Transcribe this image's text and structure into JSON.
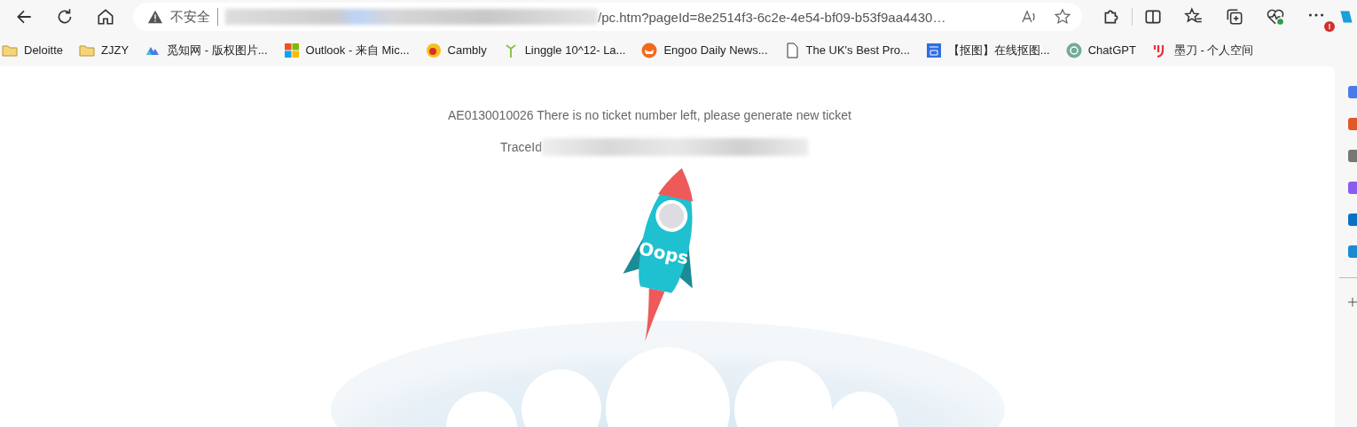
{
  "address_bar": {
    "security_label": "不安全",
    "url_visible": "/pc.htm?pageId=8e2514f3-6c2e-4e54-bf09-b53f9aa4430…"
  },
  "notification_badge": "!",
  "bookmarks": [
    {
      "kind": "folder",
      "label": "Deloitte"
    },
    {
      "kind": "folder",
      "label": "ZJZY"
    },
    {
      "kind": "zhi",
      "label": "觅知网 - 版权图片..."
    },
    {
      "kind": "windows",
      "label": "Outlook - 来自 Mic..."
    },
    {
      "kind": "cambly",
      "label": "Cambly"
    },
    {
      "kind": "sprout",
      "label": "Linggle 10^12- La..."
    },
    {
      "kind": "fox",
      "label": "Engoo Daily News..."
    },
    {
      "kind": "page",
      "label": "The UK's Best Pro..."
    },
    {
      "kind": "gao",
      "label": "【抠图】在线抠图..."
    },
    {
      "kind": "gpt",
      "label": "ChatGPT"
    },
    {
      "kind": "modao",
      "label": "墨刀 - 个人空间"
    }
  ],
  "error": {
    "message": "AE0130010026 There is no ticket number left, please generate new ticket",
    "trace_label": "TraceId"
  },
  "rocket_label": "Oops"
}
